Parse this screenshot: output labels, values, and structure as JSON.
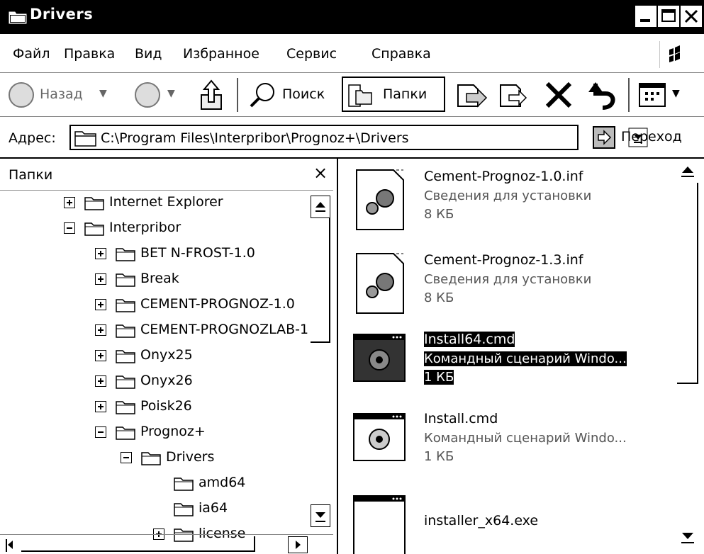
{
  "window": {
    "title": "Drivers"
  },
  "menu": [
    "Файл",
    "Правка",
    "Вид",
    "Избранное",
    "Сервис",
    "Справка"
  ],
  "toolbar": {
    "back_label": "Назад",
    "search_label": "Поиск",
    "folders_label": "Папки"
  },
  "address": {
    "label": "Адрес:",
    "path": "C:\\Program Files\\Interpribor\\Prognoz+\\Drivers",
    "go_label": "Переход"
  },
  "folders_pane": {
    "title": "Папки",
    "close": "×",
    "tree": [
      {
        "label": "Internet Explorer",
        "expander": "plus",
        "level": 0
      },
      {
        "label": "Interpribor",
        "expander": "minus",
        "level": 0
      },
      {
        "label": "BET⁠ N-FROST-1.0",
        "expander": "plus",
        "level": 1
      },
      {
        "label": "Break",
        "expander": "plus",
        "level": 1
      },
      {
        "label": "CEMENT-PROGNOZ-1.0",
        "expander": "plus",
        "level": 1
      },
      {
        "label": "CEMENT-PROGNOZLAB-1...",
        "expander": "plus",
        "level": 1
      },
      {
        "label": "Onyx25",
        "expander": "plus",
        "level": 1
      },
      {
        "label": "Onyx26",
        "expander": "plus",
        "level": 1
      },
      {
        "label": "Poisk26",
        "expander": "plus",
        "level": 1
      },
      {
        "label": "Prognoz+",
        "expander": "minus",
        "level": 1
      },
      {
        "label": "Drivers",
        "expander": "minus",
        "level": 2
      },
      {
        "label": "amd64",
        "expander": "none",
        "level": 3
      },
      {
        "label": "ia64",
        "expander": "none",
        "level": 3
      },
      {
        "label": "license",
        "expander": "plus",
        "level": 3
      }
    ]
  },
  "files": [
    {
      "name": "Cement-Prognoz-1.0.inf",
      "desc": "Сведения для установки",
      "size": "8 КБ",
      "icon": "inf-file-icon",
      "selected": false
    },
    {
      "name": "Cement-Prognoz-1.3.inf",
      "desc": "Сведения для установки",
      "size": "8 КБ",
      "icon": "inf-file-icon",
      "selected": false
    },
    {
      "name": "Install64.cmd",
      "desc": "Командный сценарий Windo...",
      "size": "1 КБ",
      "icon": "cmd-file-icon",
      "selected": true
    },
    {
      "name": "Install.cmd",
      "desc": "Командный сценарий Windo...",
      "size": "1 КБ",
      "icon": "cmd-file-icon",
      "selected": false
    },
    {
      "name": "installer_x64.exe",
      "desc": "",
      "size": "",
      "icon": "exe-file-icon",
      "selected": false
    }
  ]
}
